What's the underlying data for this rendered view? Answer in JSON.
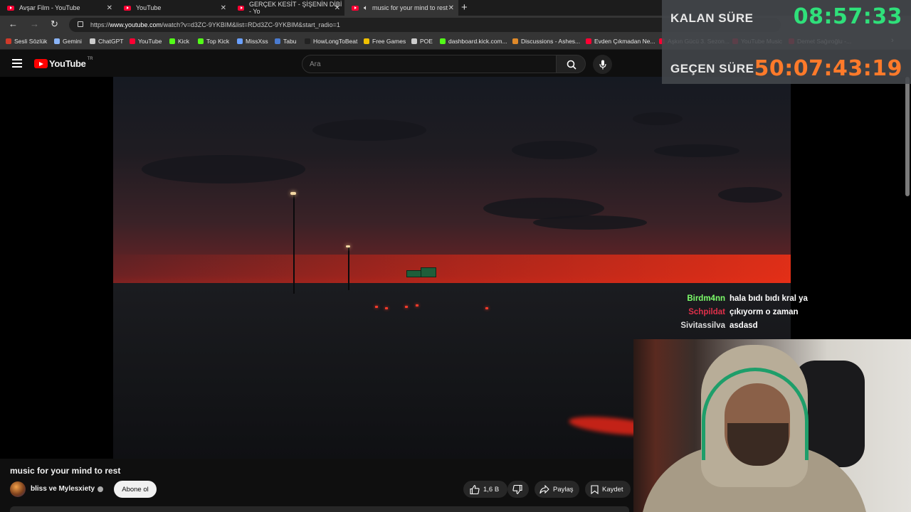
{
  "browser": {
    "tabs": [
      {
        "title": "Avşar Film - YouTube"
      },
      {
        "title": "YouTube"
      },
      {
        "title": "GERÇEK KESİT - ŞİŞENİN DİBİ - Yo"
      },
      {
        "title": "music for your mind to rest"
      }
    ],
    "url_prefix": "https://",
    "url_host": "www.youtube.com",
    "url_path": "/watch?v=d3ZC-9YKBIM&list=RDd3ZC-9YKBIM&start_radio=1",
    "bookmarks": [
      {
        "label": "Sesli Sözlük",
        "icon": "flag-icon",
        "color": "#d03a2a"
      },
      {
        "label": "Gemini",
        "icon": "sparkle-icon",
        "color": "#8ab4f8"
      },
      {
        "label": "ChatGPT",
        "icon": "openai-icon",
        "color": "#cccccc"
      },
      {
        "label": "YouTube",
        "icon": "youtube-icon",
        "color": "#ff0033"
      },
      {
        "label": "Kick",
        "icon": "kick-icon",
        "color": "#53fc18"
      },
      {
        "label": "Top Kick",
        "icon": "kick-icon",
        "color": "#53fc18"
      },
      {
        "label": "MissXss",
        "icon": "globe-icon",
        "color": "#6aa0ff"
      },
      {
        "label": "Tabu",
        "icon": "tabu-icon",
        "color": "#4a7bd0"
      },
      {
        "label": "HowLongToBeat",
        "icon": "hltb-icon",
        "color": "#222222"
      },
      {
        "label": "Free Games",
        "icon": "tag-icon",
        "color": "#f0c000"
      },
      {
        "label": "POE",
        "icon": "folder-icon",
        "color": "#cccccc"
      },
      {
        "label": "dashboard.kick.com...",
        "icon": "kick-icon",
        "color": "#53fc18"
      },
      {
        "label": "Discussions - Ashes...",
        "icon": "game-icon",
        "color": "#e08a2a"
      },
      {
        "label": "Evden Çıkmadan Ne...",
        "icon": "youtube-icon",
        "color": "#ff0033"
      },
      {
        "label": "Aşkın Gücü 3. Sezon...",
        "icon": "youtube-icon",
        "color": "#ff0033"
      },
      {
        "label": "YouTube Music",
        "icon": "ytmusic-icon",
        "color": "#ff0033"
      },
      {
        "label": "Demet Sağıroğlu -...",
        "icon": "youtube-icon",
        "color": "#ff0033"
      }
    ]
  },
  "youtube": {
    "logo_text": "YouTube",
    "country_code": "TR",
    "search_placeholder": "Ara",
    "video_title": "music for your mind to rest",
    "channel_name": "bliss ve Mylesxiety",
    "subscribe_label": "Abone ol",
    "like_count": "1,6 B",
    "share_label": "Paylaş",
    "save_label": "Kaydet"
  },
  "overlay": {
    "remaining_label": "KALAN SÜRE",
    "remaining_value": "08:57:33",
    "elapsed_label": "GEÇEN SÜRE",
    "elapsed_value": "50:07:43:19",
    "remaining_color": "#2fe07a",
    "elapsed_color": "#ff7a2a"
  },
  "chat": [
    {
      "user": "Birdm4nn",
      "message": "hala bıdı bıdı kral ya",
      "color": "#7dff6b"
    },
    {
      "user": "Schpildat",
      "message": "çıkıyorm o zaman",
      "color": "#e0304a"
    },
    {
      "user": "Sivitassilva",
      "message": "asdasd",
      "color": "#dddddd"
    }
  ]
}
